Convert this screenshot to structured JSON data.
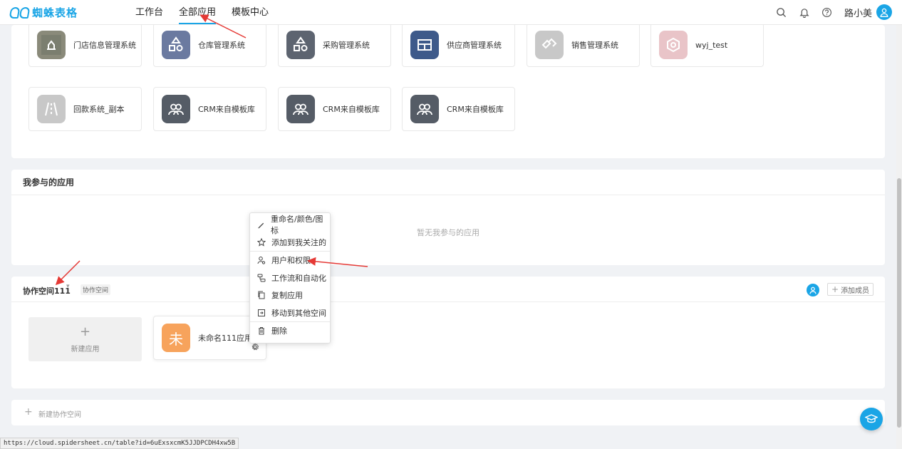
{
  "brand": {
    "name": "蜘蛛表格",
    "color": "#1aa5e6"
  },
  "nav": {
    "items": [
      "工作台",
      "全部应用",
      "模板中心"
    ],
    "active": "全部应用"
  },
  "header_right": {
    "icons": [
      "search-icon",
      "bell-icon",
      "help-icon"
    ],
    "user_name": "路小美"
  },
  "apps_row1": [
    {
      "name": "门店信息管理系统",
      "icon": "store-icon"
    },
    {
      "name": "仓库管理系统",
      "icon": "warehouse-icon"
    },
    {
      "name": "采购管理系统",
      "icon": "purchase-icon"
    },
    {
      "name": "供应商管理系统",
      "icon": "supplier-icon"
    },
    {
      "name": "销售管理系统",
      "icon": "handshake-icon"
    },
    {
      "name": "wyj_test",
      "icon": "test-icon"
    }
  ],
  "apps_row2": [
    {
      "name": "回款系统_副本",
      "icon": "road-icon"
    },
    {
      "name": "CRM来自模板库",
      "icon": "people-icon"
    },
    {
      "name": "CRM来自模板库",
      "icon": "people-icon"
    },
    {
      "name": "CRM来自模板库",
      "icon": "people-icon"
    }
  ],
  "participated": {
    "title": "我参与的应用",
    "empty_text": "暂无我参与的应用"
  },
  "context_menu": {
    "items": [
      {
        "label": "重命名/颜色/图标",
        "icon": "pencil-icon"
      },
      {
        "label": "添加到我关注的",
        "icon": "star-icon"
      },
      {
        "label": "用户和权限",
        "icon": "user-permission-icon"
      },
      {
        "label": "工作流和自动化",
        "icon": "workflow-icon"
      },
      {
        "label": "复制应用",
        "icon": "copy-icon"
      },
      {
        "label": "移动到其他空间",
        "icon": "move-icon"
      },
      {
        "label": "删除",
        "icon": "trash-icon"
      }
    ]
  },
  "workspace": {
    "name": "协作空间111",
    "tag": "协作空间",
    "add_member": "添加成员",
    "new_app": "新建应用",
    "app": {
      "name": "未命名111应用1",
      "icon_char": "未",
      "icon_color": "#f7a35c"
    }
  },
  "new_workspace": "新建协作空间",
  "status_url": "https://cloud.spidersheet.cn/table?id=6uExsxcmK5JJDPCDH4xw5B"
}
